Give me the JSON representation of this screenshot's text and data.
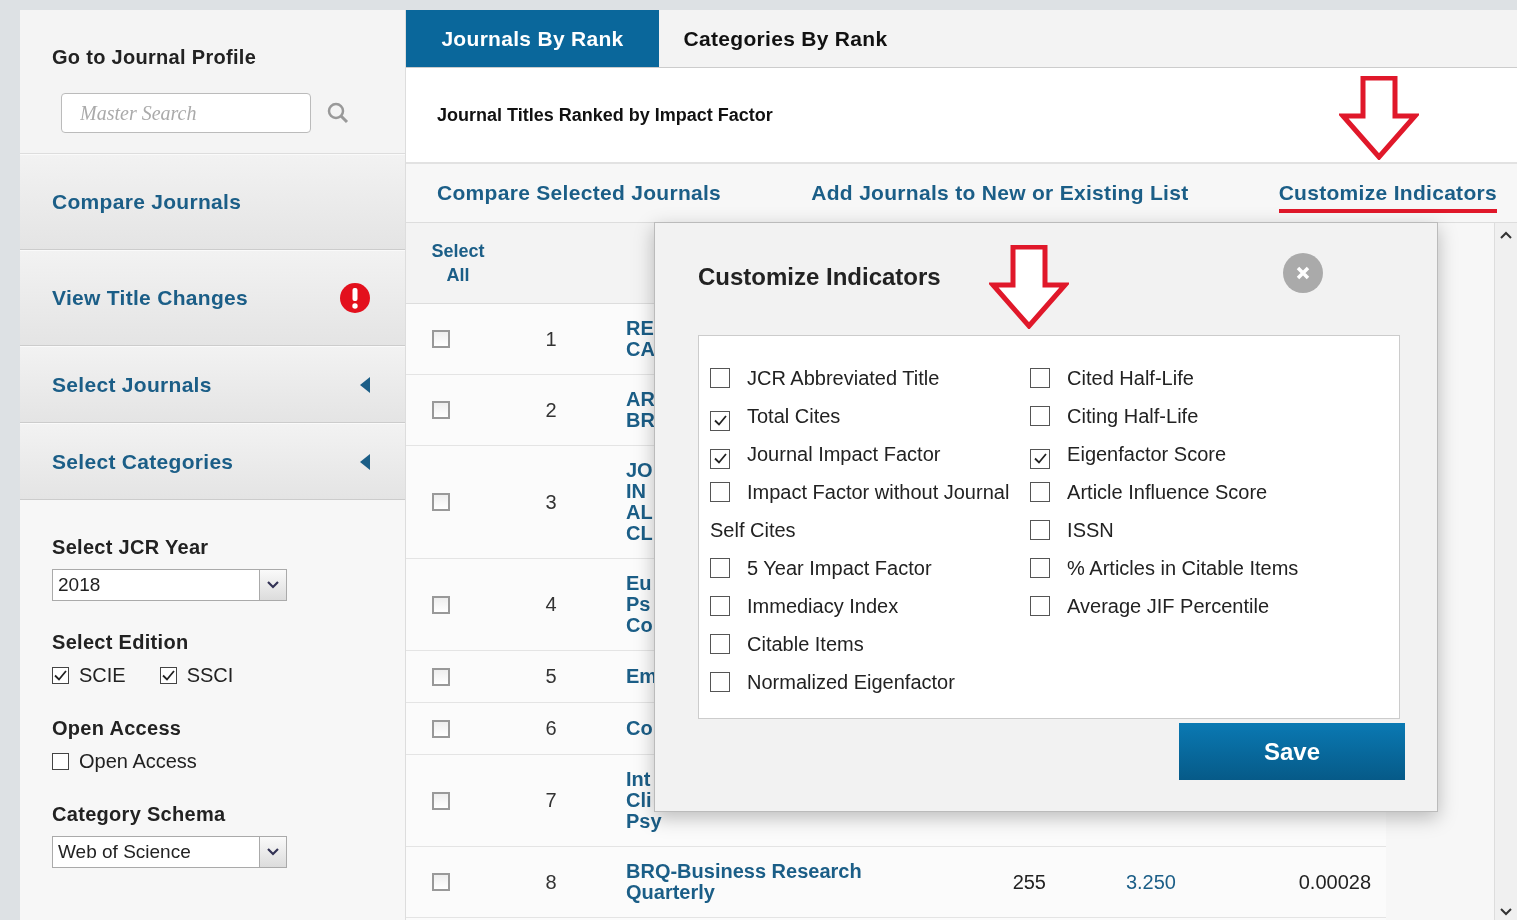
{
  "sidebar": {
    "profile": {
      "heading": "Go to Journal Profile",
      "search": {
        "placeholder": "Master Search"
      }
    },
    "nav": [
      {
        "label": "Compare Journals",
        "kind": "plain"
      },
      {
        "label": "View Title Changes",
        "kind": "alert"
      },
      {
        "label": "Select Journals",
        "kind": "collapsible",
        "expanded": false
      },
      {
        "label": "Select Categories",
        "kind": "collapsible",
        "expanded": false
      }
    ],
    "filters": [
      {
        "kind": "select",
        "label": "Select JCR Year",
        "value": "2018"
      },
      {
        "kind": "checkboxes",
        "label": "Select Edition",
        "options": [
          {
            "label": "SCIE",
            "checked": true
          },
          {
            "label": "SSCI",
            "checked": true
          }
        ]
      },
      {
        "kind": "checkboxes",
        "label": "Open Access",
        "options": [
          {
            "label": "Open Access",
            "checked": false
          }
        ]
      },
      {
        "kind": "select",
        "label": "Category Schema",
        "value": "Web of Science"
      }
    ]
  },
  "main": {
    "tabs": [
      {
        "label": "Journals By Rank",
        "selected": true
      },
      {
        "label": "Categories By Rank",
        "selected": false
      }
    ],
    "subtitle": "Journal Titles Ranked by Impact Factor",
    "actions": [
      {
        "label": "Compare Selected Journals",
        "highlighted": false
      },
      {
        "label": "Add Journals to New or Existing List",
        "highlighted": false
      },
      {
        "label": "Customize Indicators",
        "highlighted": true
      }
    ],
    "table": {
      "select_all": "Select All",
      "rows": [
        {
          "checked": false,
          "rank": "1",
          "title": [
            "RE",
            "CA"
          ]
        },
        {
          "checked": false,
          "rank": "2",
          "title": [
            "AR",
            "BR"
          ]
        },
        {
          "checked": false,
          "rank": "3",
          "title": [
            "JO",
            "IN",
            "AL",
            "CL"
          ]
        },
        {
          "checked": false,
          "rank": "4",
          "title": [
            "Eu",
            "Ps",
            "Co"
          ]
        },
        {
          "checked": false,
          "rank": "5",
          "title": [
            "Em"
          ]
        },
        {
          "checked": false,
          "rank": "6",
          "title": [
            "Co"
          ]
        },
        {
          "checked": false,
          "rank": "7",
          "title": [
            "Int",
            "Cli",
            "Psy"
          ]
        },
        {
          "checked": false,
          "rank": "8",
          "title": [
            "BRQ-Business Research",
            "Quarterly"
          ],
          "total_cites": "255",
          "impact_factor": "3.250",
          "eigenfactor": "0.00028"
        }
      ]
    },
    "modal": {
      "title": "Customize Indicators",
      "columns": [
        [
          {
            "label": "JCR Abbreviated Title",
            "checked": false
          },
          {
            "label": "Total Cites",
            "checked": true
          },
          {
            "label": "Journal Impact Factor",
            "checked": true
          },
          {
            "label": "Impact Factor without Journal Self Cites",
            "checked": false
          },
          {
            "label": "5 Year Impact Factor",
            "checked": false
          },
          {
            "label": "Immediacy Index",
            "checked": false
          },
          {
            "label": "Citable Items",
            "checked": false
          },
          {
            "label": "Normalized Eigenfactor",
            "checked": false
          }
        ],
        [
          {
            "label": "Cited Half-Life",
            "checked": false
          },
          {
            "label": "Citing Half-Life",
            "checked": false
          },
          {
            "label": "Eigenfactor Score",
            "checked": true
          },
          {
            "label": "Article Influence Score",
            "checked": false
          },
          {
            "label": "ISSN",
            "checked": false
          },
          {
            "label": "% Articles in Citable Items",
            "checked": false
          },
          {
            "label": "Average JIF Percentile",
            "checked": false
          }
        ]
      ],
      "save": "Save"
    }
  }
}
